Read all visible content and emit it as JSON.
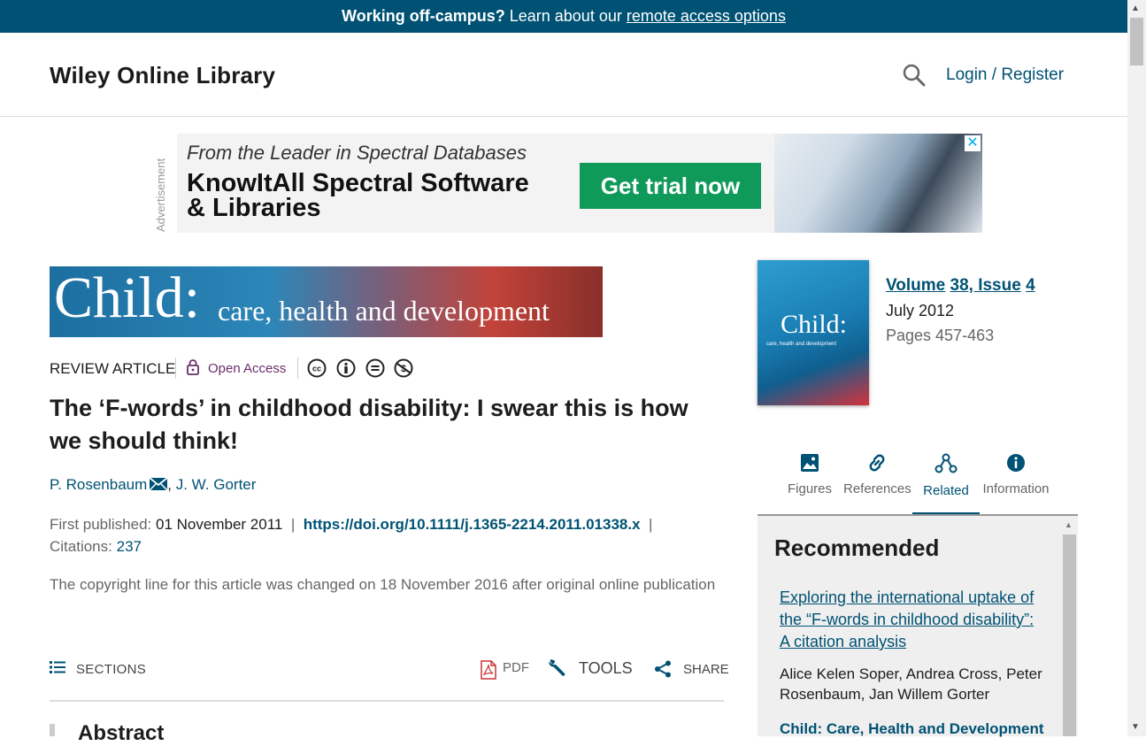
{
  "banner": {
    "lead": "Working off-campus?",
    "text": "Learn about our",
    "link": "remote access options"
  },
  "header": {
    "logo": "Wiley Online Library",
    "login": "Login / Register"
  },
  "ad": {
    "label": "Advertisement",
    "tagline": "From the Leader in Spectral Databases",
    "headline_line1": "KnowItAll Spectral Software",
    "headline_line2": "& Libraries",
    "cta": "Get trial now",
    "close": "✕"
  },
  "journal_banner": {
    "title": "Child:",
    "subtitle": "care, health and development"
  },
  "article": {
    "type": "REVIEW ARTICLE",
    "access": "Open Access",
    "title": "The ‘F-words’ in childhood disability: I swear this is how we should think!",
    "author1": "P. Rosenbaum",
    "author_sep": ",",
    "author2": "J. W. Gorter",
    "first_published_label": "First published:",
    "first_published_value": "01 November 2011",
    "sep": "|",
    "doi": "https://doi.org/10.1111/j.1365-2214.2011.01338.x",
    "citations_label": "Citations:",
    "citations_value": "237",
    "copyright_note": "The copyright line for this article was changed on 18 November 2016 after original online publication"
  },
  "toolbar": {
    "sections": "SECTIONS",
    "pdf": "PDF",
    "tools": "TOOLS",
    "share": "SHARE"
  },
  "abstract": {
    "title": "Abstract"
  },
  "issue": {
    "volume": "Volume",
    "volume_num": "38, Issue",
    "issue_num": "4",
    "date": "July 2012",
    "pages": "Pages 457-463",
    "cover_title": "Child:",
    "cover_subtitle": "care, health and development"
  },
  "tabs": [
    {
      "label": "Figures",
      "icon": "image-icon"
    },
    {
      "label": "References",
      "icon": "link-icon"
    },
    {
      "label": "Related",
      "icon": "related-icon"
    },
    {
      "label": "Information",
      "icon": "info-icon"
    }
  ],
  "recommended": {
    "heading": "Recommended",
    "item1_title": "Exploring the international uptake of the “F-words in childhood disability”: A citation analysis",
    "item1_authors_a": "Alice Kelen Soper",
    "item1_authors_b": "Andrea Cross",
    "item1_authors_c": "Peter Rosenbaum",
    "item1_authors_d": "Jan Willem Gorter",
    "item2_title": "Child: Care, Health and Development"
  },
  "colors": {
    "brand": "#005274",
    "access": "#6a2e6a",
    "cta": "#0f9a5a"
  }
}
